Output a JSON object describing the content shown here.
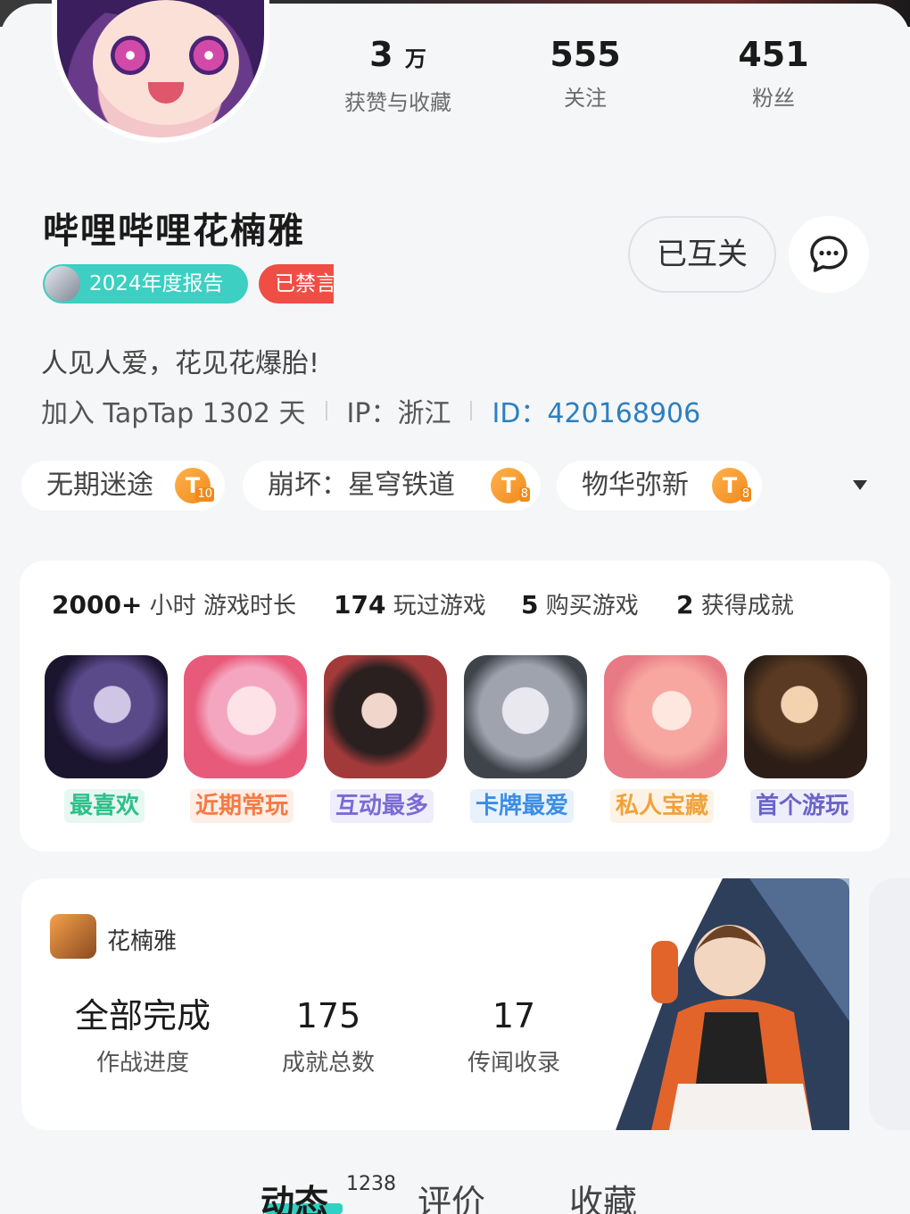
{
  "colors": {
    "accent_teal": "#3ccfc2",
    "ban_red": "#f04e45",
    "id_blue": "#2c7fc0",
    "background": "#f5f6f8"
  },
  "profile": {
    "stats": [
      {
        "num": "3",
        "unit": "万",
        "label": "获赞与收藏"
      },
      {
        "num": "555",
        "unit": "",
        "label": "关注"
      },
      {
        "num": "451",
        "unit": "",
        "label": "粉丝"
      }
    ],
    "name": "哔哩哔哩花楠雅",
    "badge_report": "2024年度报告",
    "badge_banned": "已禁言",
    "follow_button": "已互关",
    "message_icon": "chat-bubble-icon",
    "bio": "人见人爱，花见花爆胎!",
    "joined": "加入 TapTap 1302 天",
    "ip": "IP：浙江",
    "id": "ID：420168906"
  },
  "tags": [
    {
      "name": "无期迷途",
      "level": "10"
    },
    {
      "name": "崩坏：星穹铁道",
      "level": "8"
    },
    {
      "name": "物华弥新",
      "level": "8"
    }
  ],
  "game_stats": [
    {
      "value": "2000+",
      "unit": "小时",
      "label": "游戏时长"
    },
    {
      "value": "174",
      "unit": "",
      "label": "玩过游戏"
    },
    {
      "value": "5",
      "unit": "",
      "label": "购买游戏"
    },
    {
      "value": "2",
      "unit": "",
      "label": "获得成就"
    }
  ],
  "game_icons": [
    {
      "label": "最喜欢",
      "color": "#2fbf8a",
      "bg": "#e6f8f1"
    },
    {
      "label": "近期常玩",
      "color": "#f47a45",
      "bg": "#fdeee6"
    },
    {
      "label": "互动最多",
      "color": "#7a6bd6",
      "bg": "#efedfb"
    },
    {
      "label": "卡牌最爱",
      "color": "#3a8ee6",
      "bg": "#e8f2fd"
    },
    {
      "label": "私人宝藏",
      "color": "#f2a13a",
      "bg": "#fdf3e4"
    },
    {
      "label": "首个游玩",
      "color": "#6a64c8",
      "bg": "#eeedfa"
    }
  ],
  "achievement": {
    "player_name": "花楠雅",
    "items": [
      {
        "value": "全部完成",
        "label": "作战进度"
      },
      {
        "value": "175",
        "label": "成就总数"
      },
      {
        "value": "17",
        "label": "传闻收录"
      }
    ]
  },
  "tabs": {
    "feed": "动态",
    "feed_count": "1238",
    "reviews": "评价",
    "favorites": "收藏"
  }
}
